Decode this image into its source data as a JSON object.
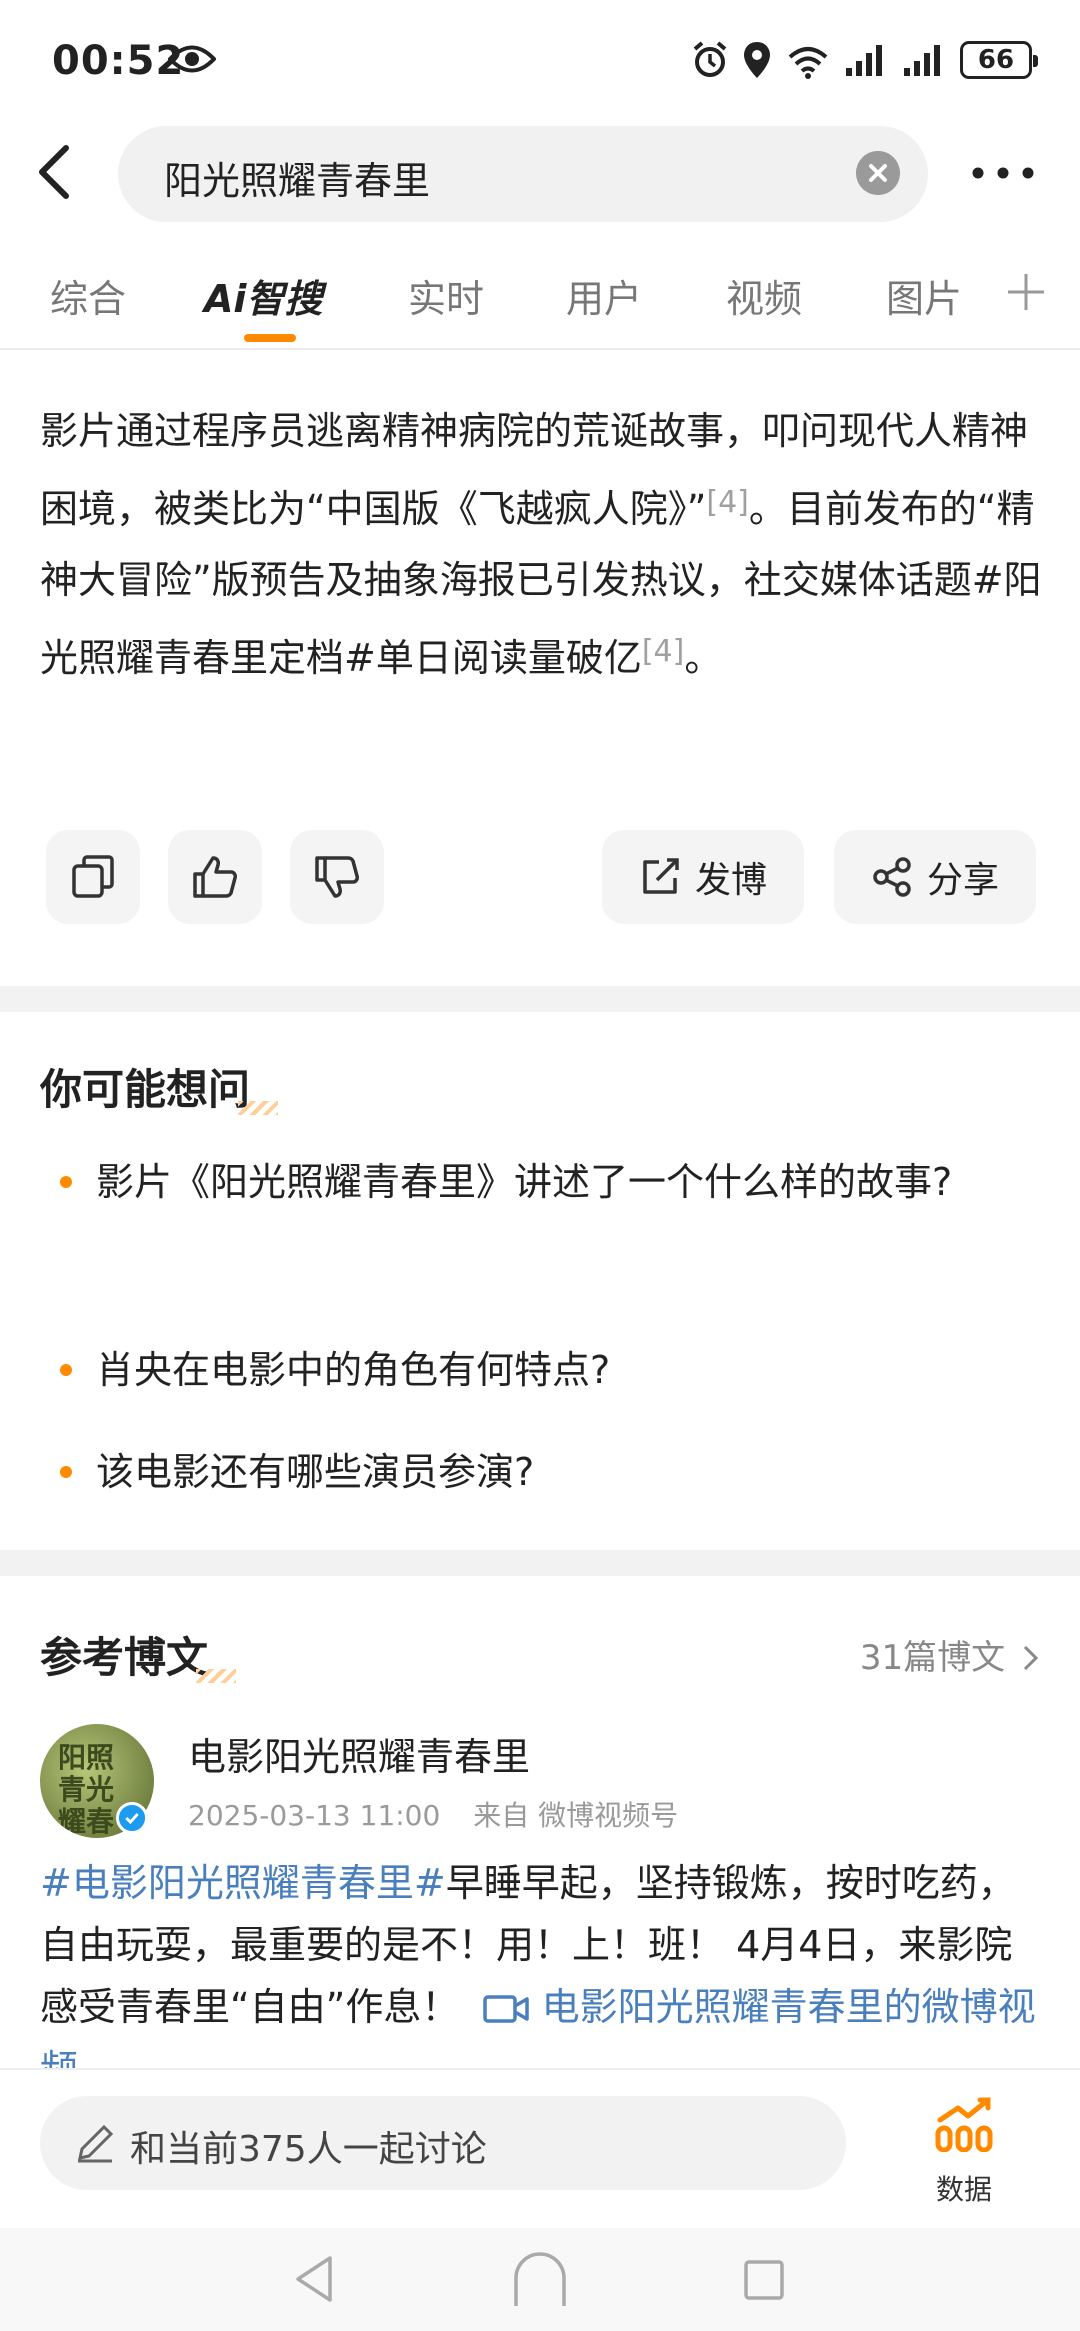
{
  "status_bar": {
    "time": "00:52",
    "battery": "66",
    "icons": [
      "eye-icon",
      "alarm-icon",
      "location-icon",
      "wifi-icon",
      "signal-icon",
      "signal-icon",
      "battery-icon"
    ]
  },
  "header": {
    "search_query": "阳光照耀青春里",
    "icons": [
      "back-icon",
      "clear-icon",
      "more-icon"
    ]
  },
  "tabs": [
    {
      "label": "综合"
    },
    {
      "label": "Ai智搜",
      "active": true
    },
    {
      "label": "实时"
    },
    {
      "label": "用户"
    },
    {
      "label": "视频"
    },
    {
      "label": "图片"
    }
  ],
  "answer": {
    "seg1": "影片通过程序员逃离精神病院的荒诞故事，叩问现代人精神困境，被类比为“中国版《飞越疯人院》”",
    "cite1": "[4]",
    "seg2": "。目前发布的“精神大冒险”版预告及抽象海报已引发热议，社交媒体话题#阳光照耀青春里定档#单日阅读量破亿",
    "cite2": "[4]",
    "seg3": "。"
  },
  "actions": {
    "post_label": "发博",
    "share_label": "分享",
    "icons": [
      "copy-icon",
      "thumbs-up-icon",
      "thumbs-down-icon",
      "compose-icon",
      "share-icon"
    ]
  },
  "questions": {
    "title": "你可能想问",
    "items": [
      "影片《阳光照耀青春里》讲述了一个什么样的故事?",
      "肖央在电影中的角色有何特点?",
      "该电影还有哪些演员参演?"
    ]
  },
  "references": {
    "title": "参考博文",
    "count": "31篇博文",
    "post": {
      "avatar_text": "阳照青光耀春里",
      "author": "电影阳光照耀青春里",
      "timestamp": "2025-03-13 11:00",
      "source": "来自 微博视频号",
      "hashtag": "#电影阳光照耀青春里#",
      "body": "早睡早起，坚持锻炼，按时吃药，自由玩耍，最重要的是不！用！上！班！ 4月4日，来影院感受青春里“自由”作息！",
      "video_link": "电影阳光照耀青春里的微博视频"
    }
  },
  "bottom": {
    "discuss_label": "和当前375人一起讨论",
    "data_label": "数据"
  },
  "colors": {
    "accent": "#ff8a00",
    "link": "#4a7fbd",
    "verified": "#1d9bf0"
  }
}
